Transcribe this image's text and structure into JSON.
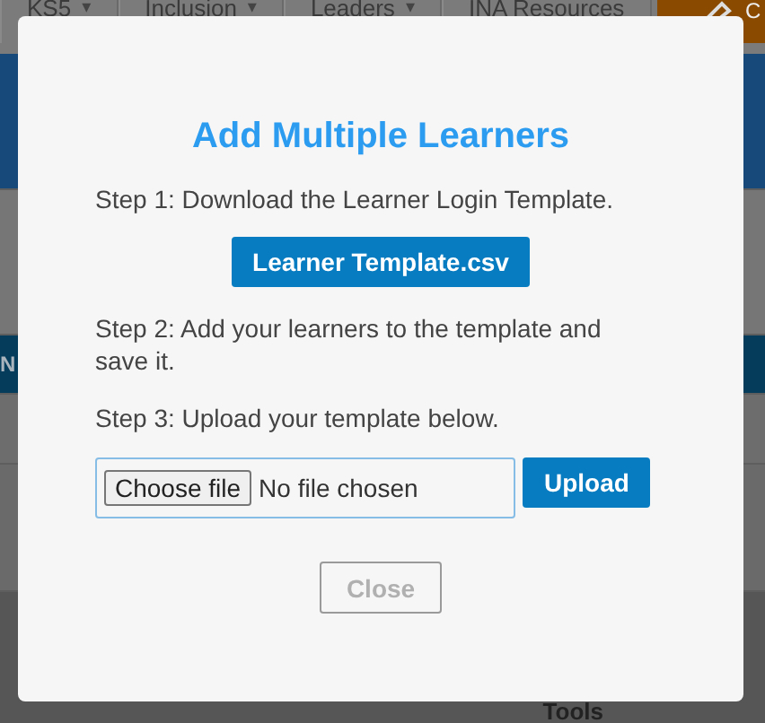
{
  "nav": {
    "items": [
      {
        "label": "KS5",
        "caret": "▾"
      },
      {
        "label": "Inclusion",
        "caret": "▾"
      },
      {
        "label": "Leaders",
        "caret": "▾"
      },
      {
        "label": "INA Resources"
      }
    ],
    "action_label": "C"
  },
  "table": {
    "header": "N"
  },
  "footer_text": "Tools",
  "modal": {
    "title": "Add Multiple Learners",
    "step_1": "Step 1: Download the Learner Login Template.",
    "template_button": "Learner Template.csv",
    "step_2": "Step 2: Add your learners to the template and save it.",
    "step_3": "Step 3: Upload your template below.",
    "file_input": {
      "button": "Choose file",
      "status": "No file chosen"
    },
    "upload_button": "Upload",
    "close_button": {
      "label": "Close",
      "disabled": true
    }
  }
}
